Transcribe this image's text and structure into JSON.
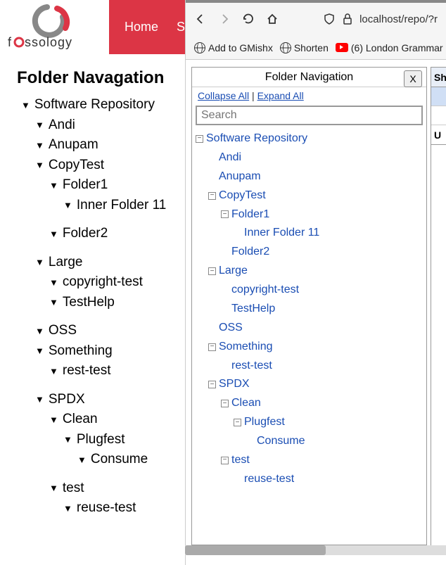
{
  "logo_text": "fossology",
  "nav": {
    "home": "Home",
    "other": "S"
  },
  "left_title": "Folder Navagation",
  "browser": {
    "url": "localhost/repo/?r",
    "bookmarks": {
      "gmishx": "Add to GMishx",
      "shorten": "Shorten",
      "london": "(6) London Grammar"
    }
  },
  "panel": {
    "title": "Folder Navigation",
    "close": "X",
    "collapse": "Collapse All",
    "expand": "Expand All",
    "search_placeholder": "Search"
  },
  "edge": {
    "sh": "Sh",
    "u": "U"
  },
  "tree": {
    "root": "Software Repository",
    "andi": "Andi",
    "anupam": "Anupam",
    "copytest": "CopyTest",
    "folder1": "Folder1",
    "inner11": "Inner Folder 11",
    "folder2": "Folder2",
    "large": "Large",
    "copyright": "copyright-test",
    "testhelp": "TestHelp",
    "oss": "OSS",
    "something": "Something",
    "resttest": "rest-test",
    "spdx": "SPDX",
    "clean": "Clean",
    "plugfest": "Plugfest",
    "consume": "Consume",
    "test": "test",
    "reusetest": "reuse-test"
  },
  "chart_data": null
}
